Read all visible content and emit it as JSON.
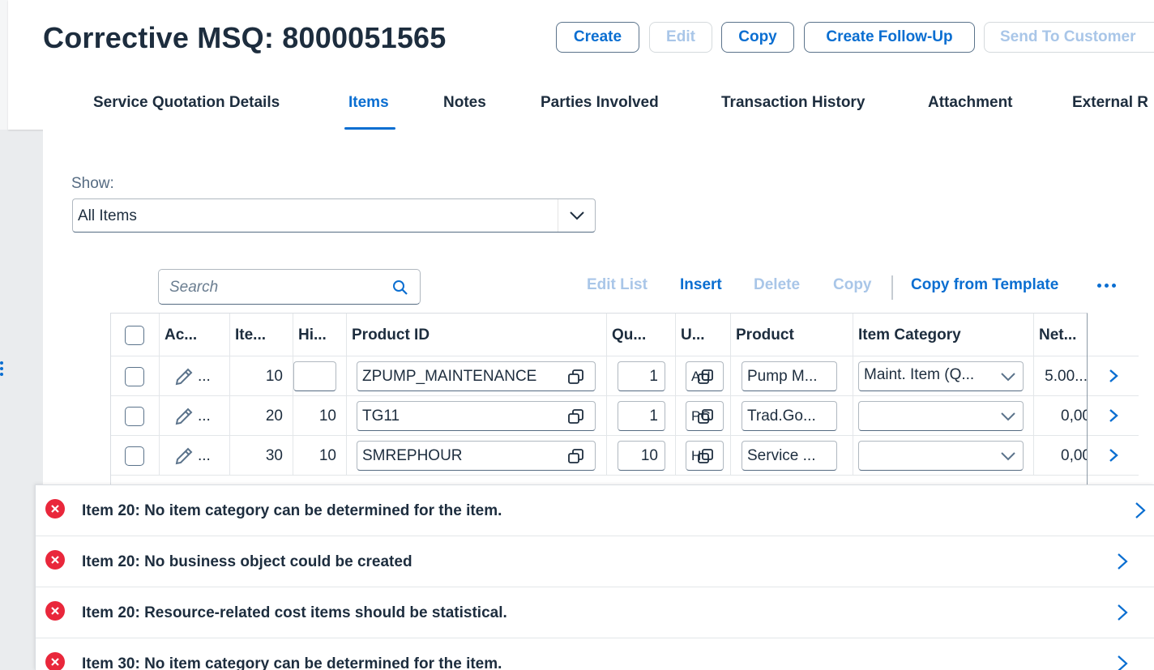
{
  "header": {
    "title": "Corrective MSQ: 8000051565",
    "buttons": {
      "create": "Create",
      "edit": "Edit",
      "copy": "Copy",
      "create_follow_up": "Create Follow-Up",
      "send_to_customer": "Send To Customer"
    }
  },
  "tabs": [
    {
      "label": "Service Quotation Details"
    },
    {
      "label": "Items"
    },
    {
      "label": "Notes"
    },
    {
      "label": "Parties Involved"
    },
    {
      "label": "Transaction History"
    },
    {
      "label": "Attachment"
    },
    {
      "label": "External R"
    }
  ],
  "active_tab": "Items",
  "filter": {
    "label": "Show:",
    "value": "All Items"
  },
  "search": {
    "placeholder": "Search"
  },
  "toolbar": {
    "edit_list": "Edit List",
    "insert": "Insert",
    "delete": "Delete",
    "copy": "Copy",
    "copy_from_template": "Copy from Template"
  },
  "table": {
    "columns": [
      "Ac...",
      "Ite...",
      "Hi...",
      "Product ID",
      "Qu...",
      "U...",
      "Product",
      "Item Category",
      "Net..."
    ],
    "rows": [
      {
        "item": "10",
        "higher": "",
        "product_id": "ZPUMP_MAINTENANCE",
        "qty": "1",
        "unit": "AU",
        "product": "Pump M...",
        "category": "Maint. Item (Q...",
        "net": "5.00..."
      },
      {
        "item": "20",
        "higher": "10",
        "product_id": "TG11",
        "qty": "1",
        "unit": "PC",
        "product": "Trad.Go...",
        "category": "",
        "net": "0,00"
      },
      {
        "item": "30",
        "higher": "10",
        "product_id": "SMREPHOUR",
        "qty": "10",
        "unit": "H",
        "product": "Service ...",
        "category": "",
        "net": "0,00"
      }
    ]
  },
  "messages": [
    {
      "text": "Item 20: No item category can be determined for the item."
    },
    {
      "text": "Item 20: No business object could be created"
    },
    {
      "text": "Item 20: Resource-related cost items should be statistical."
    },
    {
      "text": "Item 30: No item category can be determined for the item."
    }
  ],
  "colors": {
    "accent": "#0a6ed1",
    "error": "#e9273b",
    "disabled": "#a9c6e8"
  }
}
